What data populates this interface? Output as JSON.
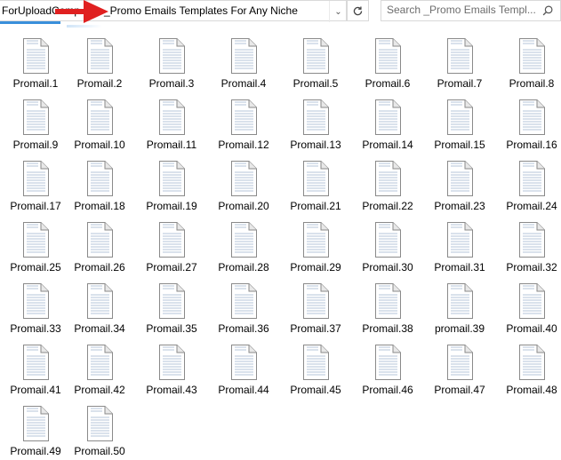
{
  "address": {
    "previous_segment": "ForUploadComp",
    "current_folder": "_Promo Emails Templates For Any Niche"
  },
  "search": {
    "placeholder": "Search _Promo Emails Templ..."
  },
  "icons": {
    "dropdown": "chevron-down-icon",
    "refresh": "refresh-icon",
    "search": "search-icon",
    "file": "document-icon",
    "annotation": "red-arrow"
  },
  "colors": {
    "arrow": "#e02020",
    "selection_underline": "#3a8fdb"
  },
  "files": [
    "Promail.1",
    "Promail.2",
    "Promail.3",
    "Promail.4",
    "Promail.5",
    "Promail.6",
    "Promail.7",
    "Promail.8",
    "Promail.9",
    "Promail.10",
    "Promail.11",
    "Promail.12",
    "Promail.13",
    "Promail.14",
    "Promail.15",
    "Promail.16",
    "Promail.17",
    "Promail.18",
    "Promail.19",
    "Promail.20",
    "Promail.21",
    "Promail.22",
    "Promail.23",
    "Promail.24",
    "Promail.25",
    "Promail.26",
    "Promail.27",
    "Promail.28",
    "Promail.29",
    "Promail.30",
    "Promail.31",
    "Promail.32",
    "Promail.33",
    "Promail.34",
    "Promail.35",
    "Promail.36",
    "Promail.37",
    "Promail.38",
    "promail.39",
    "Promail.40",
    "Promail.41",
    "Promail.42",
    "Promail.43",
    "Promail.44",
    "Promail.45",
    "Promail.46",
    "Promail.47",
    "Promail.48",
    "Promail.49",
    "Promail.50"
  ]
}
